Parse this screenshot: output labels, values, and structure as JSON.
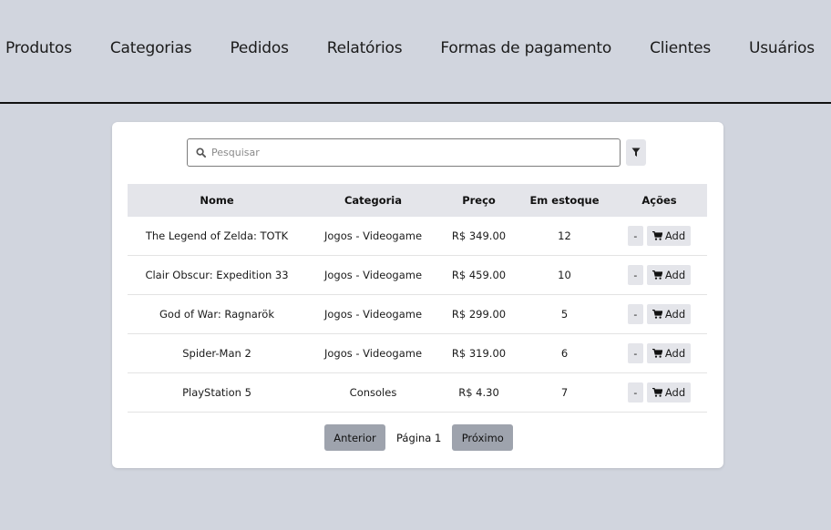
{
  "nav": {
    "items": [
      {
        "label": "Produtos"
      },
      {
        "label": "Categorias"
      },
      {
        "label": "Pedidos"
      },
      {
        "label": "Relatórios"
      },
      {
        "label": "Formas de pagamento"
      },
      {
        "label": "Clientes"
      },
      {
        "label": "Usuários"
      }
    ]
  },
  "search": {
    "placeholder": "Pesquisar",
    "value": "",
    "icon": "search-icon",
    "filter_icon": "filter-icon"
  },
  "table": {
    "headers": [
      "Nome",
      "Categoria",
      "Preço",
      "Em estoque",
      "Ações"
    ],
    "rows": [
      {
        "name": "The Legend of Zelda: TOTK",
        "category": "Jogos - Videogame",
        "price": "R$ 349.00",
        "stock": "12"
      },
      {
        "name": "Clair Obscur: Expedition 33",
        "category": "Jogos - Videogame",
        "price": "R$ 459.00",
        "stock": "10"
      },
      {
        "name": "God of War: Ragnarök",
        "category": "Jogos - Videogame",
        "price": "R$ 299.00",
        "stock": "5"
      },
      {
        "name": "Spider-Man 2",
        "category": "Jogos - Videogame",
        "price": "R$ 319.00",
        "stock": "6"
      },
      {
        "name": "PlayStation 5",
        "category": "Consoles",
        "price": "R$ 4.30",
        "stock": "7"
      }
    ],
    "remove_label": "-",
    "add_label": "Add",
    "add_icon": "cart-icon"
  },
  "pagination": {
    "prev_label": "Anterior",
    "page_label": "Página 1",
    "next_label": "Próximo"
  },
  "colors": {
    "page_background": "#d1d5de",
    "card_background": "#ffffff",
    "header_background": "#e4e5ea",
    "pagination_button": "#9ea3ad"
  }
}
